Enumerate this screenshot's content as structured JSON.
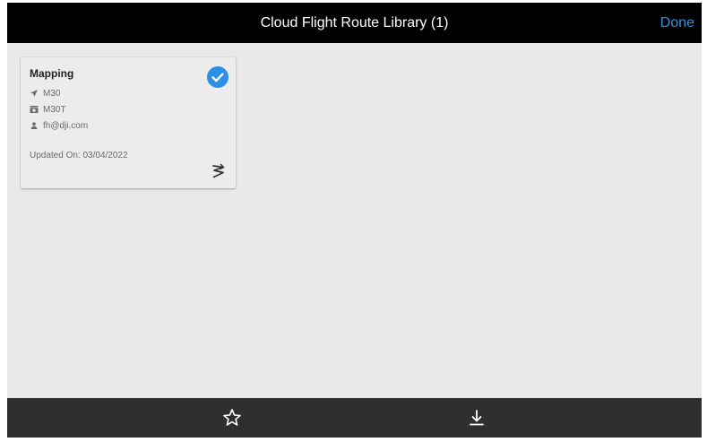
{
  "header": {
    "title": "Cloud Flight Route Library (1)",
    "done_label": "Done",
    "accent_color": "#2f8fe6"
  },
  "routes": [
    {
      "name": "Mapping",
      "selected": true,
      "aircraft": "M30",
      "camera": "M30T",
      "user": "fh@dji.com",
      "updated": "Updated On: 03/04/2022",
      "icons": {
        "aircraft": "plane-icon",
        "camera": "camera-icon",
        "user": "user-icon",
        "route": "route-icon",
        "selected": "check-circle-icon"
      }
    }
  ],
  "bottom_bar": {
    "favorite_icon": "star-outline-icon",
    "download_icon": "download-icon"
  }
}
